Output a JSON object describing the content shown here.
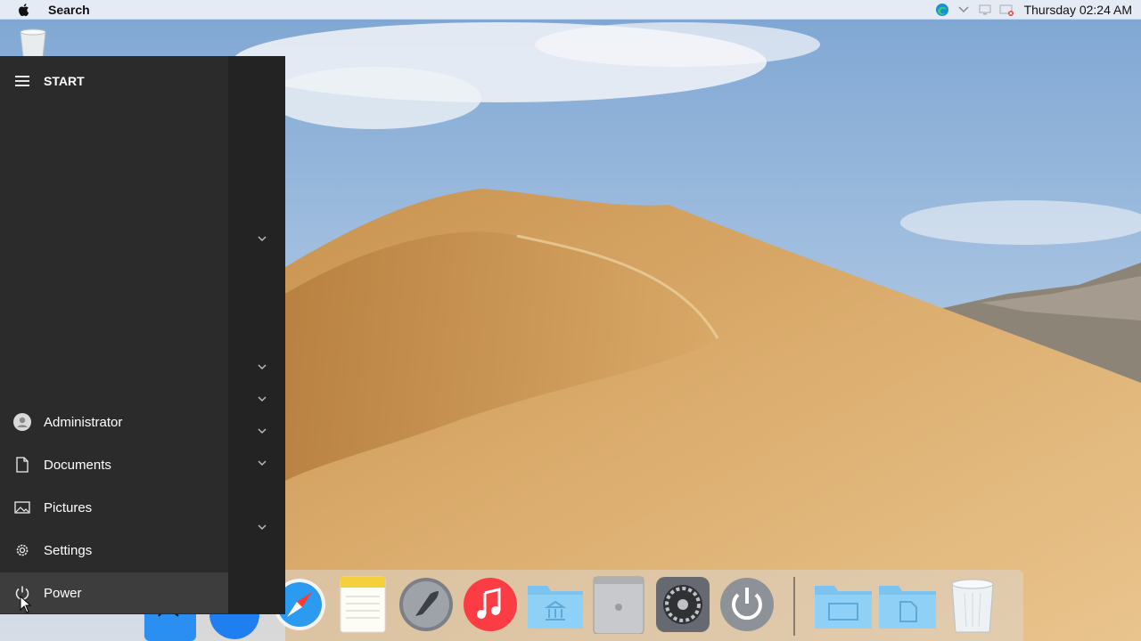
{
  "menubar": {
    "app_name": "Search",
    "clock": "Thursday 02:24 AM"
  },
  "start_menu": {
    "title": "START",
    "items": [
      {
        "label": "Administrator",
        "icon": "user-icon"
      },
      {
        "label": "Documents",
        "icon": "document-icon"
      },
      {
        "label": "Pictures",
        "icon": "pictures-icon"
      },
      {
        "label": "Settings",
        "icon": "gear-icon"
      },
      {
        "label": "Power",
        "icon": "power-icon"
      }
    ]
  },
  "dock": {
    "items": [
      "finder-icon",
      "app-store-icon",
      "safari-icon",
      "notes-icon",
      "launchpad-icon",
      "music-icon",
      "applications-folder-icon",
      "mac-pro-icon",
      "system-preferences-icon",
      "power-icon",
      "desktop-folder-icon",
      "documents-folder-icon",
      "trash-icon"
    ]
  },
  "colors": {
    "start_bg": "#2b2b2b",
    "start_side": "#232323",
    "hover": "#3d3d3d",
    "sand": "#d9a867",
    "sky": "#8fb3d9"
  }
}
